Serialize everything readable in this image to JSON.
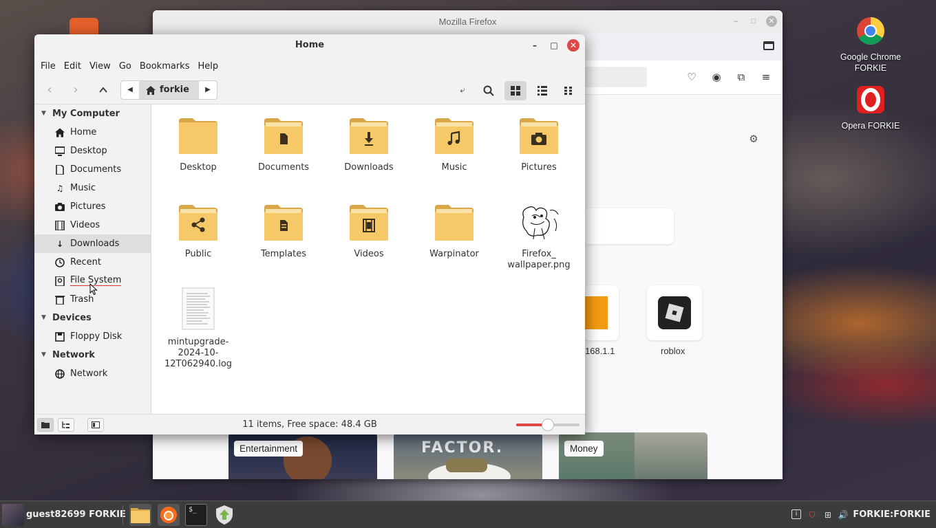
{
  "desktop": {
    "icons": [
      {
        "label_1": "Google Chrome",
        "label_2": "FORKIE",
        "icon": "chrome-icon"
      },
      {
        "label_1": "Opera FORKIE",
        "icon": "opera-icon"
      }
    ]
  },
  "firefox": {
    "title": "Mozilla Firefox",
    "shortcuts": [
      {
        "label": "168.1.1"
      },
      {
        "label": "roblox"
      }
    ],
    "news_tags": [
      "Entertainment",
      "Money"
    ],
    "news_image_text": "FACTOR."
  },
  "file_manager": {
    "title": "Home",
    "menu": [
      "File",
      "Edit",
      "View",
      "Go",
      "Bookmarks",
      "Help"
    ],
    "path_crumb": "forkie",
    "sidebar": {
      "sections": [
        {
          "title": "My Computer",
          "items": [
            {
              "label": "Home",
              "icon": "home-icon"
            },
            {
              "label": "Desktop",
              "icon": "desktop-icon"
            },
            {
              "label": "Documents",
              "icon": "document-icon"
            },
            {
              "label": "Music",
              "icon": "music-icon"
            },
            {
              "label": "Pictures",
              "icon": "camera-icon"
            },
            {
              "label": "Videos",
              "icon": "film-icon"
            },
            {
              "label": "Downloads",
              "icon": "download-icon"
            },
            {
              "label": "Recent",
              "icon": "clock-icon"
            },
            {
              "label": "File System",
              "icon": "drive-icon"
            },
            {
              "label": "Trash",
              "icon": "trash-icon"
            }
          ]
        },
        {
          "title": "Devices",
          "items": [
            {
              "label": "Floppy Disk",
              "icon": "floppy-icon"
            }
          ]
        },
        {
          "title": "Network",
          "items": [
            {
              "label": "Network",
              "icon": "network-icon"
            }
          ]
        }
      ]
    },
    "files": [
      {
        "name": "Desktop",
        "icon": "folder-icon"
      },
      {
        "name": "Documents",
        "icon": "folder-documents-icon"
      },
      {
        "name": "Downloads",
        "icon": "folder-downloads-icon"
      },
      {
        "name": "Music",
        "icon": "folder-music-icon"
      },
      {
        "name": "Pictures",
        "icon": "folder-pictures-icon"
      },
      {
        "name": "Public",
        "icon": "folder-public-icon"
      },
      {
        "name": "Templates",
        "icon": "folder-templates-icon"
      },
      {
        "name": "Videos",
        "icon": "folder-videos-icon"
      },
      {
        "name": "Warpinator",
        "icon": "folder-icon"
      },
      {
        "name": "Firefox_ wallpaper.png",
        "icon": "image-thumbnail-icon"
      },
      {
        "name": "mintupgrade-2024-10-12T062940.log",
        "icon": "text-file-icon"
      }
    ],
    "status": "11 items, Free space: 48.4 GB",
    "zoom_level": 0.5
  },
  "taskbar": {
    "user": "guest82699 FORKIE",
    "host": "FORKIE:FORKIE"
  },
  "colors": {
    "folder": "#f6c867",
    "folder_dark": "#d9a64a",
    "accent": "#e04848"
  }
}
